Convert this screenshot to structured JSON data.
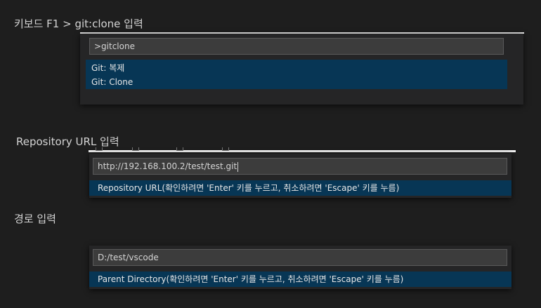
{
  "sections": [
    {
      "caption": "키보드 F1 > git:clone 입력",
      "input_value": ">gitclone",
      "items": [
        {
          "label": "Git: 복제"
        },
        {
          "label": "Git: Clone"
        }
      ]
    },
    {
      "caption": "Repository URL 입력",
      "input_value": "http://192.168.100.2/test/test.git",
      "hint": "Repository URL(확인하려면 'Enter' 키를 누르고, 취소하려면 'Escape' 키를 누름)"
    },
    {
      "caption": "경로 입력",
      "input_value": "D:/test/vscode",
      "hint": "Parent Directory(확인하려면 'Enter' 키를 누르고, 취소하려면 'Escape' 키를 누름)"
    }
  ]
}
